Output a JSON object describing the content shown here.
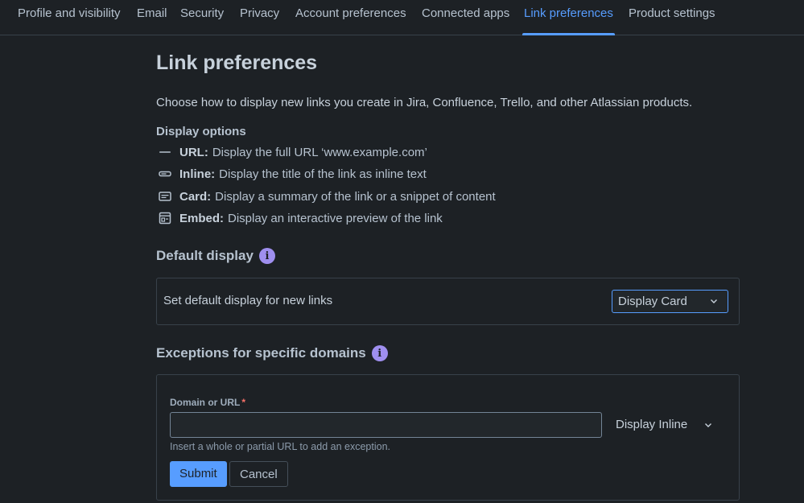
{
  "nav": {
    "tabs": [
      {
        "label": "Profile and visibility"
      },
      {
        "label": "Email"
      },
      {
        "label": "Security"
      },
      {
        "label": "Privacy"
      },
      {
        "label": "Account preferences"
      },
      {
        "label": "Connected apps"
      },
      {
        "label": "Link preferences",
        "active": true
      },
      {
        "label": "Product settings"
      }
    ]
  },
  "page": {
    "title": "Link preferences",
    "intro": "Choose how to display new links you create in Jira, Confluence, Trello, and other Atlassian products."
  },
  "display_options": {
    "heading": "Display options",
    "items": [
      {
        "icon": "url-icon",
        "name": "URL:",
        "desc": "Display the full URL ‘www.example.com’"
      },
      {
        "icon": "inline-icon",
        "name": "Inline:",
        "desc": "Display the title of the link as inline text"
      },
      {
        "icon": "card-icon",
        "name": "Card:",
        "desc": "Display a summary of the link or a snippet of content"
      },
      {
        "icon": "embed-icon",
        "name": "Embed:",
        "desc": "Display an interactive preview of the link"
      }
    ]
  },
  "default_display": {
    "heading": "Default display",
    "label": "Set default display for new links",
    "selected": "Display Card"
  },
  "exceptions": {
    "heading": "Exceptions for specific domains",
    "field_label": "Domain or URL",
    "required_marker": "*",
    "input_value": "",
    "select_value": "Display Inline",
    "helper": "Insert a whole or partial URL to add an exception.",
    "submit_label": "Submit",
    "cancel_label": "Cancel"
  },
  "colors": {
    "background": "#1d2125",
    "accent": "#579dff",
    "info": "#9f8fef",
    "required": "#f87168"
  }
}
